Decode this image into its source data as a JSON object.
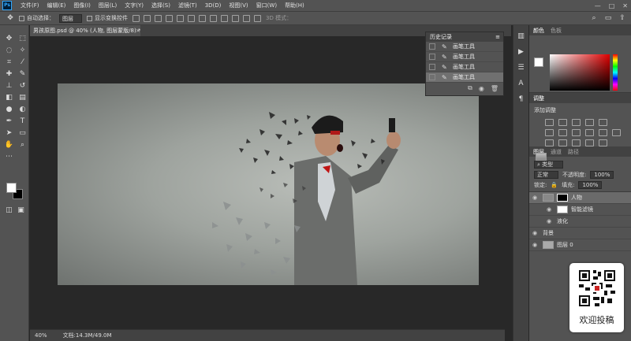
{
  "menubar": {
    "logo": "Ps",
    "items": [
      "文件(F)",
      "编辑(E)",
      "图像(I)",
      "图层(L)",
      "文字(Y)",
      "选择(S)",
      "滤镜(T)",
      "3D(D)",
      "视图(V)",
      "窗口(W)",
      "帮助(H)"
    ],
    "controls": [
      "—",
      "□",
      "✕"
    ]
  },
  "options": {
    "auto_select_label": "自动选择：",
    "auto_select_value": "图层",
    "show_transform_label": "显示变换控件",
    "mode_3d_label": "3D 模式："
  },
  "document": {
    "tab_title": "男孩原图.psd @ 40% (人物, 图层蒙版/8) *",
    "zoom": "40%",
    "doc_size": "文档:14.3M/49.0M"
  },
  "history": {
    "title": "历史记录",
    "items": [
      "画笔工具",
      "画笔工具",
      "画笔工具",
      "画笔工具"
    ]
  },
  "color_panel": {
    "tabs": [
      "颜色",
      "色板"
    ]
  },
  "adjustments": {
    "tab": "调整",
    "add_label": "添加调整"
  },
  "layers_panel": {
    "tabs": [
      "图层",
      "通道",
      "路径"
    ],
    "filter_kind": "类型",
    "blend_mode": "正常",
    "opacity_label": "不透明度:",
    "opacity_value": "100%",
    "lock_label": "锁定:",
    "fill_label": "填充:",
    "fill_value": "100%",
    "layers": [
      {
        "name": "人物"
      },
      {
        "name": "智能滤镜"
      },
      {
        "name": "液化"
      },
      {
        "name": "背景"
      },
      {
        "name": "图层 0"
      }
    ]
  },
  "badge": {
    "text": "欢迎投稿"
  },
  "colors": {
    "foreground": "#ffffff",
    "background": "#000000"
  }
}
